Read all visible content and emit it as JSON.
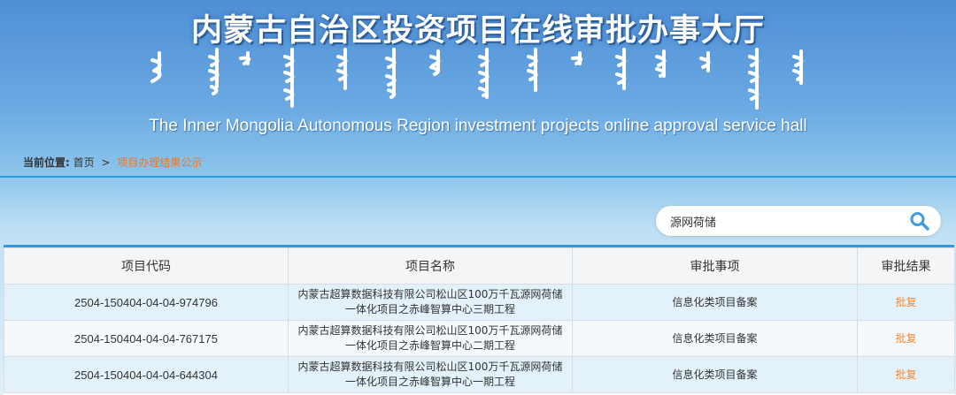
{
  "header": {
    "title_cn": "内蒙古自治区投资项目在线审批办事大厅",
    "title_en": "The Inner Mongolia Autonomous Region investment projects online approval service hall"
  },
  "breadcrumb": {
    "label": "当前位置:",
    "home": "首页",
    "separator": ">",
    "current": "项目办理结果公示"
  },
  "search": {
    "value": "源网荷储",
    "icon": "search-icon"
  },
  "table": {
    "headers": [
      "项目代码",
      "项目名称",
      "审批事项",
      "审批结果"
    ],
    "rows": [
      {
        "code": "2504-150404-04-04-974796",
        "name_line1": "内蒙古超算数据科技有限公司松山区100万千瓦源网荷储",
        "name_line2": "一体化项目之赤峰智算中心三期工程",
        "item": "信息化类项目备案",
        "result": "批复"
      },
      {
        "code": "2504-150404-04-04-767175",
        "name_line1": "内蒙古超算数据科技有限公司松山区100万千瓦源网荷储",
        "name_line2": "一体化项目之赤峰智算中心二期工程",
        "item": "信息化类项目备案",
        "result": "批复"
      },
      {
        "code": "2504-150404-04-04-644304",
        "name_line1": "内蒙古超算数据科技有限公司松山区100万千瓦源网荷储",
        "name_line2": "一体化项目之赤峰智算中心一期工程",
        "item": "信息化类项目备案",
        "result": "批复"
      }
    ]
  },
  "colors": {
    "accent": "#2d9be4",
    "link_orange": "#e8772e",
    "result_orange": "#f08a3c"
  }
}
